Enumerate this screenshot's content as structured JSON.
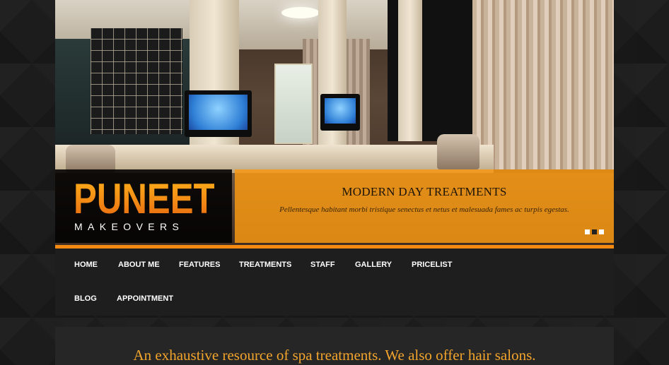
{
  "brand": {
    "name": "PUNEET",
    "tagline": "MAKEOVERS",
    "accent_color": "#f48a12"
  },
  "slider": {
    "title": "MODERN DAY TREATMENTS",
    "text": "Pellentesque habitant morbi tristique senectus et netus et malesuada fames ac turpis egestas.",
    "slide_count": 3,
    "active_slide": 2
  },
  "nav": {
    "items": [
      {
        "label": "HOME"
      },
      {
        "label": "ABOUT ME"
      },
      {
        "label": "FEATURES"
      },
      {
        "label": "TREATMENTS"
      },
      {
        "label": "STAFF"
      },
      {
        "label": "GALLERY"
      },
      {
        "label": "PRICELIST"
      },
      {
        "label": "BLOG"
      },
      {
        "label": "APPOINTMENT"
      }
    ]
  },
  "content": {
    "heading": "An exhaustive resource of spa treatments. We also offer hair salons."
  },
  "colors": {
    "caption_bg": "#f79812",
    "heading": "#f2a42c",
    "nav_bg": "#1e1e1e"
  }
}
